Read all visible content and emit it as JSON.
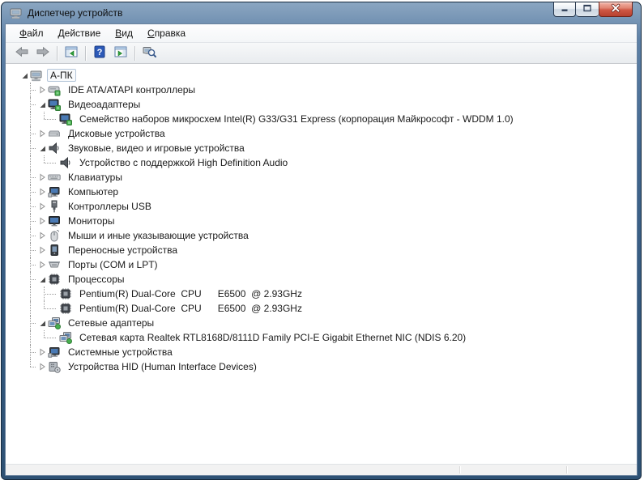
{
  "window": {
    "title": "Диспетчер устройств",
    "controls": [
      {
        "name": "minimize-button",
        "icon": "minimize-icon"
      },
      {
        "name": "maximize-button",
        "icon": "maximize-icon"
      },
      {
        "name": "close-button",
        "icon": "close-icon"
      }
    ]
  },
  "menu_bar": {
    "items": [
      {
        "name": "menu-file",
        "label": "Файл"
      },
      {
        "name": "menu-action",
        "label": "Действие"
      },
      {
        "name": "menu-view",
        "label": "Вид"
      },
      {
        "name": "menu-help",
        "label": "Справка"
      }
    ]
  },
  "toolbar": {
    "buttons": [
      {
        "name": "back-button",
        "icon": "back-arrow-icon"
      },
      {
        "name": "forward-button",
        "icon": "forward-arrow-icon"
      },
      {
        "name": "separator"
      },
      {
        "name": "show-console-tree-button",
        "icon": "console-window-left-arrow-icon"
      },
      {
        "name": "separator"
      },
      {
        "name": "help-button",
        "icon": "help-icon"
      },
      {
        "name": "show-action-pane-button",
        "icon": "console-window-right-arrow-icon"
      },
      {
        "name": "separator"
      },
      {
        "name": "scan-hardware-button",
        "icon": "scan-hardware-icon"
      }
    ]
  },
  "tree": {
    "items": [
      {
        "name": "tree-item-a-pk",
        "label": "А-ПК",
        "level": 0,
        "state": "expanded",
        "icon": "computer-icon",
        "selected": true
      },
      {
        "name": "tree-item-ide",
        "label": "IDE ATA/ATAPI контроллеры",
        "level": 1,
        "state": "collapsed",
        "icon": "ide-controller-icon"
      },
      {
        "name": "tree-item-video-adapters",
        "label": "Видеоадаптеры",
        "level": 1,
        "state": "expanded",
        "icon": "video-adapter-icon"
      },
      {
        "name": "tree-item-video-device",
        "label": "Семейство наборов микросхем Intel(R) G33/G31 Express (корпорация Майкрософт - WDDM 1.0)",
        "level": 2,
        "state": "leaf",
        "icon": "video-adapter-icon"
      },
      {
        "name": "tree-item-disk-drives",
        "label": "Дисковые устройства",
        "level": 1,
        "state": "collapsed",
        "icon": "disk-drive-icon"
      },
      {
        "name": "tree-item-sound",
        "label": "Звуковые, видео и игровые устройства",
        "level": 1,
        "state": "expanded",
        "icon": "audio-icon"
      },
      {
        "name": "tree-item-hd-audio",
        "label": "Устройство с поддержкой High Definition Audio",
        "level": 2,
        "state": "leaf",
        "icon": "audio-icon"
      },
      {
        "name": "tree-item-keyboards",
        "label": "Клавиатуры",
        "level": 1,
        "state": "collapsed",
        "icon": "keyboard-icon"
      },
      {
        "name": "tree-item-computer",
        "label": "Компьютер",
        "level": 1,
        "state": "collapsed",
        "icon": "system-icon"
      },
      {
        "name": "tree-item-usb",
        "label": "Контроллеры USB",
        "level": 1,
        "state": "collapsed",
        "icon": "usb-icon"
      },
      {
        "name": "tree-item-monitors",
        "label": "Мониторы",
        "level": 1,
        "state": "collapsed",
        "icon": "monitor-icon"
      },
      {
        "name": "tree-item-mice",
        "label": "Мыши и иные указывающие устройства",
        "level": 1,
        "state": "collapsed",
        "icon": "mouse-icon"
      },
      {
        "name": "tree-item-portable",
        "label": "Переносные устройства",
        "level": 1,
        "state": "collapsed",
        "icon": "portable-device-icon"
      },
      {
        "name": "tree-item-ports",
        "label": "Порты (COM и LPT)",
        "level": 1,
        "state": "collapsed",
        "icon": "port-icon"
      },
      {
        "name": "tree-item-processors",
        "label": "Процессоры",
        "level": 1,
        "state": "expanded",
        "icon": "processor-icon"
      },
      {
        "name": "tree-item-cpu-1",
        "label": "Pentium(R) Dual-Core  CPU      E6500  @ 2.93GHz",
        "level": 2,
        "state": "leaf",
        "icon": "processor-icon"
      },
      {
        "name": "tree-item-cpu-2",
        "label": "Pentium(R) Dual-Core  CPU      E6500  @ 2.93GHz",
        "level": 2,
        "state": "leaf",
        "icon": "processor-icon"
      },
      {
        "name": "tree-item-network-adapters",
        "label": "Сетевые адаптеры",
        "level": 1,
        "state": "expanded",
        "icon": "network-adapter-icon"
      },
      {
        "name": "tree-item-network-card",
        "label": "Сетевая карта Realtek RTL8168D/8111D Family PCI-E Gigabit Ethernet NIC (NDIS 6.20)",
        "level": 2,
        "state": "leaf",
        "icon": "network-adapter-icon"
      },
      {
        "name": "tree-item-system-devices",
        "label": "Системные устройства",
        "level": 1,
        "state": "collapsed",
        "icon": "system-icon"
      },
      {
        "name": "tree-item-hid",
        "label": "Устройства HID (Human Interface Devices)",
        "level": 1,
        "state": "collapsed",
        "icon": "hid-icon"
      }
    ]
  },
  "status_bar": {
    "panes": [
      "",
      "",
      ""
    ]
  },
  "colors": {
    "titlebar_blue": "#41668e",
    "close_red": "#cf5744",
    "badge_green": "#48b04f",
    "screen_blue": "#4a7ab5",
    "tree_text": "#1a1a1a"
  }
}
